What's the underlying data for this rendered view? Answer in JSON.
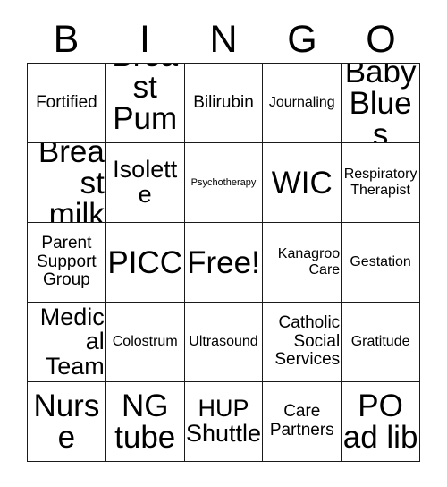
{
  "card": {
    "header_letters": [
      "B",
      "I",
      "N",
      "G",
      "O"
    ],
    "rows": [
      [
        {
          "text": "Fortified",
          "size": "fs-m",
          "align": "align-center"
        },
        {
          "text": "Breast Pump",
          "size": "fs-h",
          "align": "align-center"
        },
        {
          "text": "Bilirubin",
          "size": "fs-m",
          "align": "align-center"
        },
        {
          "text": "Journaling",
          "size": "fs-s",
          "align": "align-center"
        },
        {
          "text": "Baby Blues",
          "size": "fs-h",
          "align": "align-center"
        }
      ],
      [
        {
          "text": "Breast milk",
          "size": "fs-h",
          "align": "align-right"
        },
        {
          "text": "Isolette",
          "size": "fs-xl",
          "align": "align-center"
        },
        {
          "text": "Psychotherapy",
          "size": "fs-xxs",
          "align": "align-center"
        },
        {
          "text": "WIC",
          "size": "fs-h",
          "align": "align-center"
        },
        {
          "text": "Respiratory Therapist",
          "size": "fs-s",
          "align": "align-center"
        }
      ],
      [
        {
          "text": "Parent Support Group",
          "size": "fs-m",
          "align": "align-center"
        },
        {
          "text": "PICC",
          "size": "fs-h",
          "align": "align-center"
        },
        {
          "text": "Free!",
          "size": "fs-h",
          "align": "align-center"
        },
        {
          "text": "Kanagroo Care",
          "size": "fs-s",
          "align": "align-right"
        },
        {
          "text": "Gestation",
          "size": "fs-s",
          "align": "align-center"
        }
      ],
      [
        {
          "text": "Medical Team",
          "size": "fs-xl",
          "align": "align-right"
        },
        {
          "text": "Colostrum",
          "size": "fs-s",
          "align": "align-center"
        },
        {
          "text": "Ultrasound",
          "size": "fs-s",
          "align": "align-center"
        },
        {
          "text": "Catholic Social Services",
          "size": "fs-m",
          "align": "align-right"
        },
        {
          "text": "Gratitude",
          "size": "fs-s",
          "align": "align-center"
        }
      ],
      [
        {
          "text": "Nurse",
          "size": "fs-h",
          "align": "align-center"
        },
        {
          "text": "NG tube",
          "size": "fs-h",
          "align": "align-center"
        },
        {
          "text": "HUP Shuttle",
          "size": "fs-xl",
          "align": "align-center"
        },
        {
          "text": "Care Partners",
          "size": "fs-m",
          "align": "align-center"
        },
        {
          "text": "PO ad lib",
          "size": "fs-h",
          "align": "align-center"
        }
      ]
    ],
    "colors": {
      "border": "#1a1a1a",
      "cell_background": "#ffffff",
      "text": "#000000",
      "page_background": "#ffffff"
    }
  }
}
